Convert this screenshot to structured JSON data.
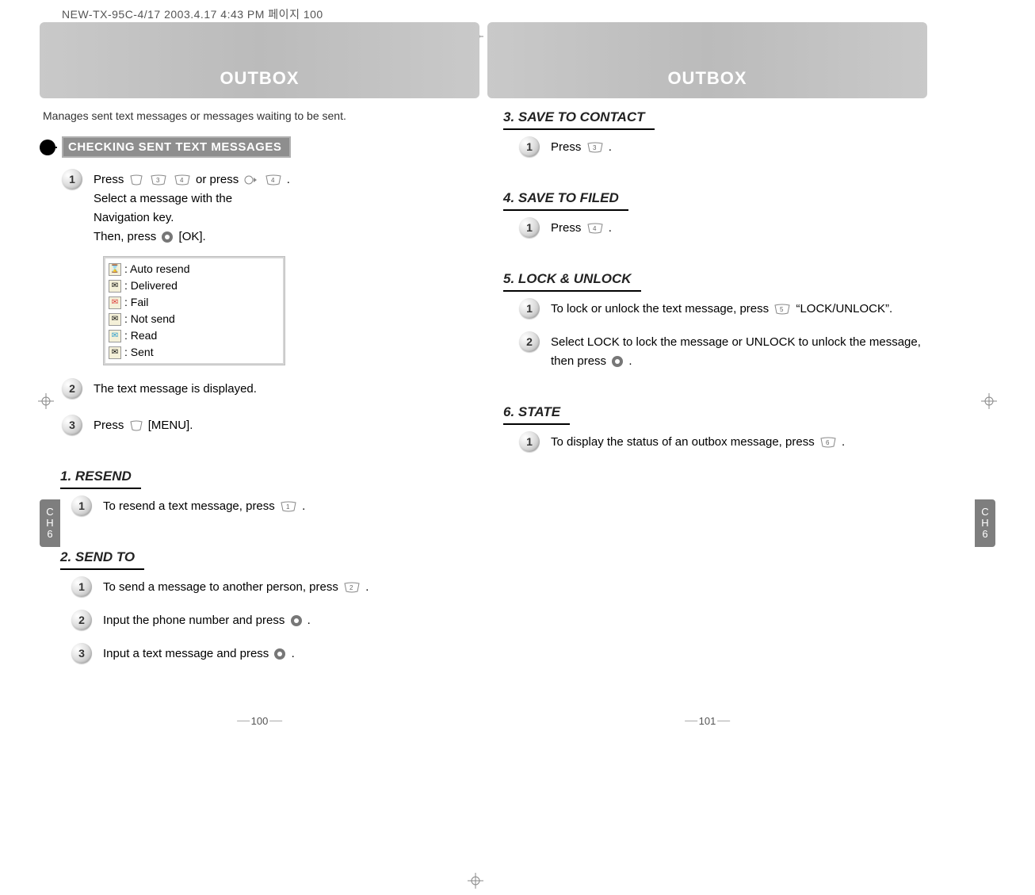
{
  "print_header": "NEW-TX-95C-4/17  2003.4.17 4:43 PM  페이지 100",
  "side_tab_label": "CH6",
  "page_left": {
    "title": "OUTBOX",
    "intro": "Manages sent text messages or messages waiting to be sent.",
    "section_title": "CHECKING SENT TEXT MESSAGES",
    "step1a": "Press ",
    "step1b": " or press ",
    "step1c": ".",
    "step1_line2": "Select a message with the",
    "step1_line3": "Navigation key.",
    "step1d_pre": "Then, press ",
    "step1d_post": " [OK].",
    "status": [
      ": Auto resend",
      ": Delivered",
      ": Fail",
      ": Not send",
      ": Read",
      ": Sent"
    ],
    "step2": "The text message is displayed.",
    "step3_pre": "Press ",
    "step3_post": " [MENU].",
    "sub1_title": "1. RESEND",
    "sub1_step1_pre": "To resend a text message, press ",
    "sub1_step1_post": " .",
    "sub2_title": "2. SEND TO",
    "sub2_step1_pre": "To send a message to another person, press ",
    "sub2_step1_post": ".",
    "sub2_step2_pre": "Input the phone number and press ",
    "sub2_step2_post": " .",
    "sub2_step3_pre": "Input a text message and press ",
    "sub2_step3_post": " .",
    "page_num": "100"
  },
  "page_right": {
    "title": "OUTBOX",
    "sub3_title": "3. SAVE TO CONTACT",
    "sub3_step1_pre": "Press ",
    "sub3_step1_post": ".",
    "sub4_title": "4. SAVE TO FILED",
    "sub4_step1_pre": "Press ",
    "sub4_step1_post": ".",
    "sub5_title": "5. LOCK & UNLOCK",
    "sub5_step1_pre": "To lock or unlock the text message, press ",
    "sub5_step1_post": " “LOCK/UNLOCK”.",
    "sub5_step2_pre": "Select LOCK to lock the message or UNLOCK to unlock the message, then press ",
    "sub5_step2_post": " .",
    "sub6_title": "6. STATE",
    "sub6_step1_pre": "To display the status of an outbox message, press ",
    "sub6_step1_post": " .",
    "page_num": "101"
  }
}
